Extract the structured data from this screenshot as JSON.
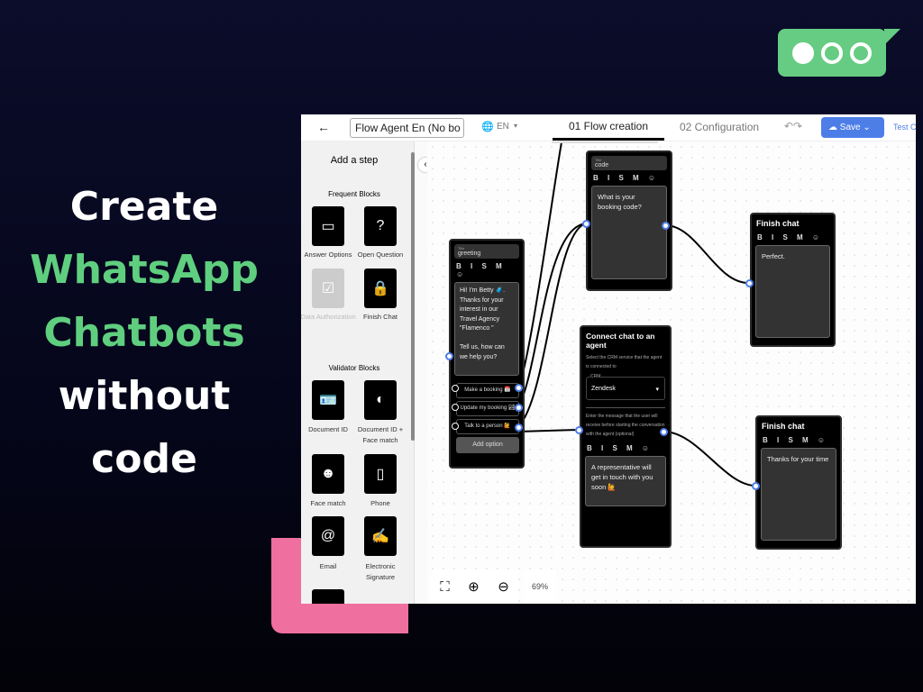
{
  "hero": {
    "line1": "Create",
    "line2": "WhatsApp",
    "line3": "Chatbots",
    "line4": "without",
    "line5": "code"
  },
  "colors": {
    "brand_green": "#66cc83",
    "accent_pink": "#ef6f9e",
    "save_blue": "#4d7ee8"
  },
  "header": {
    "back_icon": "arrow-left",
    "flow_name": "Flow Agent En (No bo",
    "language": "EN",
    "tabs": [
      {
        "label": "01 Flow creation",
        "active": true
      },
      {
        "label": "02 Configuration",
        "active": false
      }
    ],
    "save_label": "Save",
    "test_label": "Test C"
  },
  "sidebar": {
    "title": "Add a step",
    "frequent_title": "Frequent Blocks",
    "frequent": [
      {
        "label": "Answer Options",
        "icon": "answer-options"
      },
      {
        "label": "Open Question",
        "icon": "question"
      },
      {
        "label": "Data Authorization",
        "icon": "checklist",
        "disabled": true
      },
      {
        "label": "Finish Chat",
        "icon": "lock"
      }
    ],
    "validator_title": "Validator Blocks",
    "validator": [
      {
        "label": "Document ID",
        "icon": "id-card"
      },
      {
        "label": "Document ID + Face match",
        "icon": "id-face"
      },
      {
        "label": "Face match",
        "icon": "face"
      },
      {
        "label": "Phone",
        "icon": "phone"
      },
      {
        "label": "Email",
        "icon": "at"
      },
      {
        "label": "Electronic Signature",
        "icon": "signature"
      }
    ]
  },
  "nodes": {
    "greeting": {
      "title_label": "Title",
      "title": "greeting",
      "format": "B I S M ☺",
      "message": "Hi! I'm Betty 🧳. Thanks for your interest in our Travel Agency \"Flamenco \"\n\nTell us, how can we help you?",
      "options": [
        "Make a booking 📅",
        "Update my booking 🏞",
        "Talk to a person 🙋"
      ],
      "add_option": "Add option"
    },
    "code": {
      "title_label": "Title",
      "title": "code",
      "format": "B I S M ☺",
      "message": "What is your booking code?"
    },
    "finish1": {
      "heading": "Finish chat",
      "format": "B I S M ☺",
      "message": "Perfect."
    },
    "connect": {
      "heading": "Connect chat to an agent",
      "crm_desc": "Select the CRM service that the agent is connected to",
      "crm_label": "CRM",
      "crm_value": "Zendesk",
      "msg_desc": "Enter the message that the user will receive before starting the conversation with the agent (optional)",
      "format": "B I S M ☺",
      "message": "A representative will get in touch with you soon 🙋"
    },
    "finish2": {
      "heading": "Finish chat",
      "format": "B I S M ☺",
      "message": "Thanks for your time"
    }
  },
  "zoom": {
    "level": "69%"
  }
}
